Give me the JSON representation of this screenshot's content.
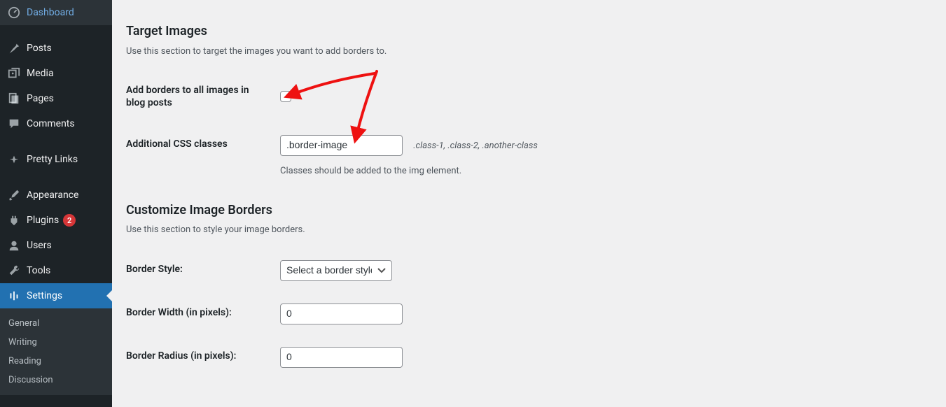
{
  "sidebar": {
    "items": [
      {
        "label": "Dashboard",
        "icon": "dashboard-icon"
      },
      {
        "label": "Posts",
        "icon": "pin-icon"
      },
      {
        "label": "Media",
        "icon": "media-icon"
      },
      {
        "label": "Pages",
        "icon": "page-icon"
      },
      {
        "label": "Comments",
        "icon": "comment-icon"
      },
      {
        "label": "Pretty Links",
        "icon": "star-icon"
      },
      {
        "label": "Appearance",
        "icon": "brush-icon"
      },
      {
        "label": "Plugins",
        "icon": "plugin-icon",
        "badge": "2"
      },
      {
        "label": "Users",
        "icon": "user-icon"
      },
      {
        "label": "Tools",
        "icon": "wrench-icon"
      },
      {
        "label": "Settings",
        "icon": "settings-icon",
        "active": true
      }
    ],
    "submenu": [
      {
        "label": "General"
      },
      {
        "label": "Writing"
      },
      {
        "label": "Reading"
      },
      {
        "label": "Discussion"
      }
    ]
  },
  "section1": {
    "heading": "Target Images",
    "desc": "Use this section to target the images you want to add borders to.",
    "row1_label": "Add borders to all images in blog posts",
    "row2_label": "Additional CSS classes",
    "css_value": ".border-image",
    "css_hint_inline": ".class-1, .class-2, .another-class",
    "css_hint_below": "Classes should be added to the img element."
  },
  "section2": {
    "heading": "Customize Image Borders",
    "desc": "Use this section to style your image borders.",
    "row1_label": "Border Style:",
    "style_placeholder": "Select a border style...",
    "row2_label": "Border Width (in pixels):",
    "width_value": "0",
    "row3_label": "Border Radius (in pixels):",
    "radius_value": "0"
  }
}
